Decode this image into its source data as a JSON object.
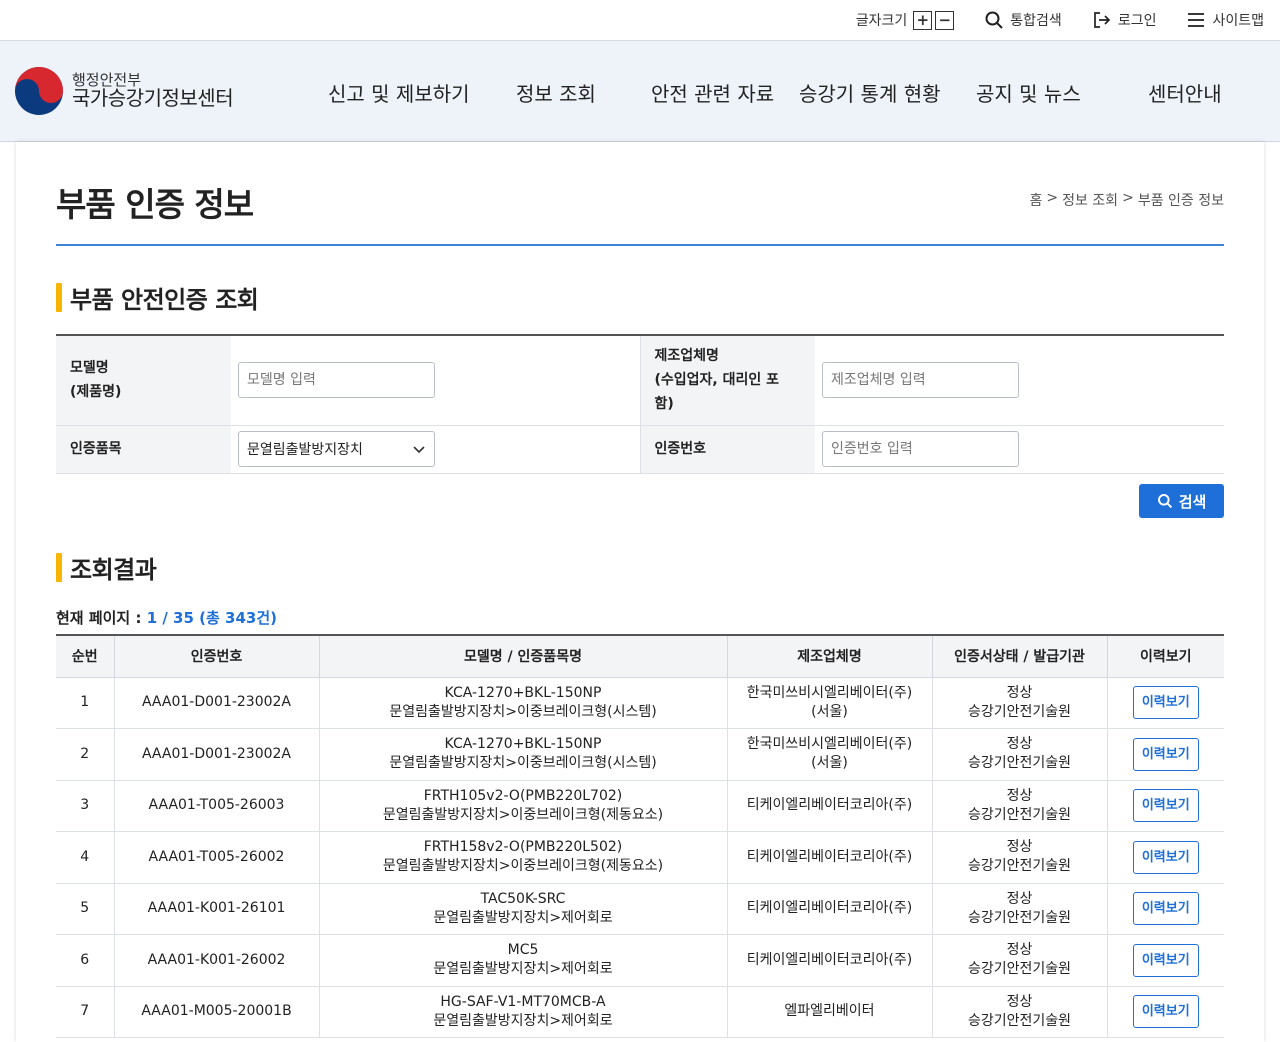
{
  "util": {
    "font_size_label": "글자크기",
    "font_plus": "+",
    "font_minus": "−",
    "search_label": "통합검색",
    "login_label": "로그인",
    "sitemap_label": "사이트맵"
  },
  "logo": {
    "sub": "행정안전부",
    "main": "국가승강기정보센터"
  },
  "gnb": [
    "신고 및 제보하기",
    "정보 조회",
    "안전 관련 자료",
    "승강기 통계 현황",
    "공지 및 뉴스",
    "센터안내"
  ],
  "page": {
    "title": "부품 인증 정보",
    "breadcrumb": [
      "홈",
      ">",
      "정보 조회",
      ">",
      "부품 인증 정보"
    ]
  },
  "search_section": {
    "title": "부품 안전인증 조회",
    "model_label_1": "모델명",
    "model_label_2": "(제품명)",
    "model_placeholder": "모델명 입력",
    "maker_label_1": "제조업체명",
    "maker_label_2": "(수입업자, 대리인 포",
    "maker_label_3": "함)",
    "maker_placeholder": "제조업체명 입력",
    "item_label": "인증품목",
    "item_value": "문열림출발방지장치",
    "cert_label": "인증번호",
    "cert_placeholder": "인증번호 입력",
    "search_button": "검색"
  },
  "results": {
    "title": "조회결과",
    "page_label": "현재 페이지 :",
    "page_value": "1 / 35 (총 343건)",
    "headers": [
      "순번",
      "인증번호",
      "모델명 / 인증품목명",
      "제조업체명",
      "인증서상태 / 발급기관",
      "이력보기"
    ],
    "history_button": "이력보기",
    "rows": [
      {
        "no": "1",
        "cert": "AAA01-D001-23002A",
        "model": "KCA-1270+BKL-150NP",
        "item": "문열림출발방지장치>이중브레이크형(시스템)",
        "maker": "한국미쓰비시엘리베이터(주)",
        "maker2": "(서울)",
        "status": "정상",
        "issuer": "승강기안전기술원"
      },
      {
        "no": "2",
        "cert": "AAA01-D001-23002A",
        "model": "KCA-1270+BKL-150NP",
        "item": "문열림출발방지장치>이중브레이크형(시스템)",
        "maker": "한국미쓰비시엘리베이터(주)",
        "maker2": "(서울)",
        "status": "정상",
        "issuer": "승강기안전기술원"
      },
      {
        "no": "3",
        "cert": "AAA01-T005-26003",
        "model": "FRTH105v2-O(PMB220L702)",
        "item": "문열림출발방지장치>이중브레이크형(제동요소)",
        "maker": "티케이엘리베이터코리아(주)",
        "maker2": "",
        "status": "정상",
        "issuer": "승강기안전기술원"
      },
      {
        "no": "4",
        "cert": "AAA01-T005-26002",
        "model": "FRTH158v2-O(PMB220L502)",
        "item": "문열림출발방지장치>이중브레이크형(제동요소)",
        "maker": "티케이엘리베이터코리아(주)",
        "maker2": "",
        "status": "정상",
        "issuer": "승강기안전기술원"
      },
      {
        "no": "5",
        "cert": "AAA01-K001-26101",
        "model": "TAC50K-SRC",
        "item": "문열림출발방지장치>제어회로",
        "maker": "티케이엘리베이터코리아(주)",
        "maker2": "",
        "status": "정상",
        "issuer": "승강기안전기술원"
      },
      {
        "no": "6",
        "cert": "AAA01-K001-26002",
        "model": "MC5",
        "item": "문열림출발방지장치>제어회로",
        "maker": "티케이엘리베이터코리아(주)",
        "maker2": "",
        "status": "정상",
        "issuer": "승강기안전기술원"
      },
      {
        "no": "7",
        "cert": "AAA01-M005-20001B",
        "model": "HG-SAF-V1-MT70MCB-A",
        "item": "문열림출발방지장치>제어회로",
        "maker": "엘파엘리베이터",
        "maker2": "",
        "status": "정상",
        "issuer": "승강기안전기술원"
      }
    ]
  }
}
